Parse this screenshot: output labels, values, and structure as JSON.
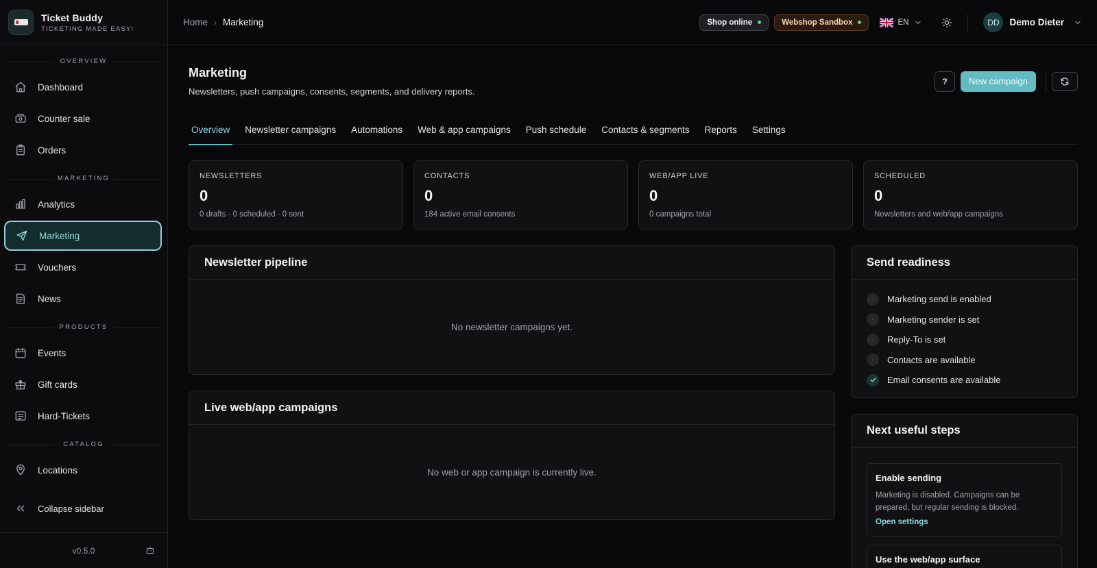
{
  "brand": {
    "name": "Ticket Buddy",
    "tagline": "TICKETING MADE EASY!"
  },
  "sidebar": {
    "sections": {
      "overview": "OVERVIEW",
      "marketing": "MARKETING",
      "products": "PRODUCTS",
      "catalog": "CATALOG"
    },
    "items": {
      "dashboard": "Dashboard",
      "counter_sale": "Counter sale",
      "orders": "Orders",
      "analytics": "Analytics",
      "marketing": "Marketing",
      "vouchers": "Vouchers",
      "news": "News",
      "events": "Events",
      "gift_cards": "Gift cards",
      "hard_tickets": "Hard-Tickets",
      "locations": "Locations"
    },
    "collapse": "Collapse sidebar",
    "version": "v0.5.0"
  },
  "topbar": {
    "breadcrumb": {
      "home": "Home",
      "current": "Marketing"
    },
    "shop_status": "Shop online",
    "sandbox": "Webshop Sandbox",
    "language": "EN",
    "user": {
      "initials": "DD",
      "name": "Demo Dieter"
    }
  },
  "page": {
    "title": "Marketing",
    "subtitle": "Newsletters, push campaigns, consents, segments, and delivery reports.",
    "help": "?",
    "new_campaign": "New campaign"
  },
  "tabs": [
    "Overview",
    "Newsletter campaigns",
    "Automations",
    "Web & app campaigns",
    "Push schedule",
    "Contacts & segments",
    "Reports",
    "Settings"
  ],
  "stats": [
    {
      "label": "NEWSLETTERS",
      "value": "0",
      "note": "0 drafts · 0 scheduled · 0 sent"
    },
    {
      "label": "CONTACTS",
      "value": "0",
      "note": "184 active email consents"
    },
    {
      "label": "WEB/APP LIVE",
      "value": "0",
      "note": "0 campaigns total"
    },
    {
      "label": "SCHEDULED",
      "value": "0",
      "note": "Newsletters and web/app campaigns"
    }
  ],
  "pipeline": {
    "title": "Newsletter pipeline",
    "empty": "No newsletter campaigns yet."
  },
  "live": {
    "title": "Live web/app campaigns",
    "empty": "No web or app campaign is currently live."
  },
  "readiness": {
    "title": "Send readiness",
    "items": [
      {
        "label": "Marketing send is enabled",
        "ok": false,
        "mark": "·"
      },
      {
        "label": "Marketing sender is set",
        "ok": false,
        "mark": "·"
      },
      {
        "label": "Reply-To is set",
        "ok": false,
        "mark": "·"
      },
      {
        "label": "Contacts are available",
        "ok": false,
        "mark": "·"
      },
      {
        "label": "Email consents are available",
        "ok": true,
        "mark": ""
      }
    ]
  },
  "next_steps": {
    "title": "Next useful steps",
    "steps": [
      {
        "title": "Enable sending",
        "desc": "Marketing is disabled. Campaigns can be prepared, but regular sending is blocked.",
        "link": "Open settings"
      },
      {
        "title": "Use the web/app surface"
      }
    ]
  },
  "colors": {
    "accent": "#63bcc1",
    "accent_text": "#8fd9da",
    "background": "#09090b",
    "panel": "#111113",
    "sandbox": "#fcd9b0",
    "online_dot": "#4ade80"
  }
}
